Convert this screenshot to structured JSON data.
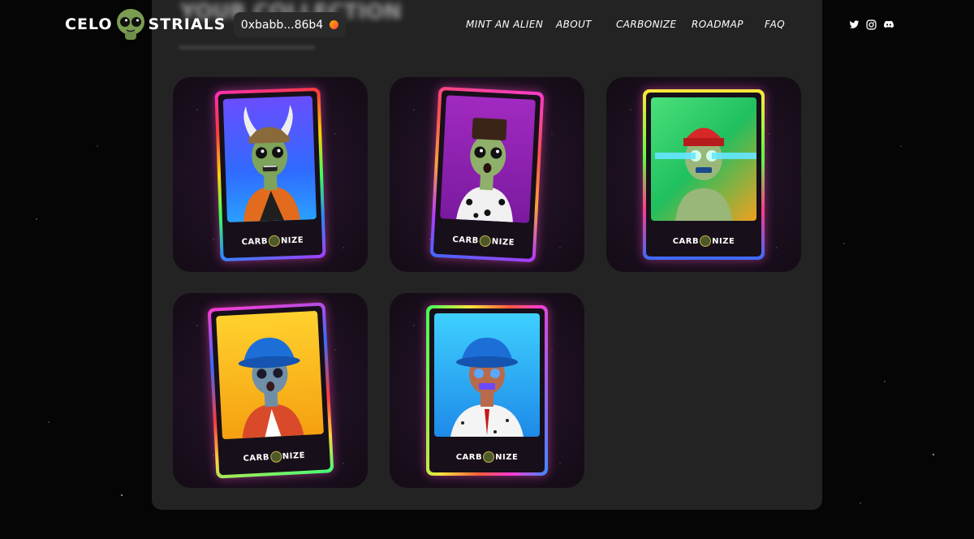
{
  "header": {
    "logo_left": "CELO",
    "logo_right": "STRIALS",
    "wallet_address": "0xbabb...86b4",
    "nav": [
      "MINT AN ALIEN",
      "ABOUT",
      "CARBONIZE",
      "ROADMAP",
      "FAQ"
    ],
    "socials": [
      "twitter-icon",
      "instagram-icon",
      "discord-icon"
    ]
  },
  "cards": [
    {
      "label_left": "CARB",
      "label_right": "NIZE",
      "background": "#3b5bff",
      "accessory": "viking-helmet",
      "skin": "#7ea35a"
    },
    {
      "label_left": "CARB",
      "label_right": "NIZE",
      "background": "#a12ac0",
      "accessory": "flat-top-hair",
      "skin": "#8fb06a"
    },
    {
      "label_left": "CARB",
      "label_right": "NIZE",
      "background": "#2fd06a",
      "accessory": "red-beanie-laser-eyes",
      "skin": "#9ab77a"
    },
    {
      "label_left": "CARB",
      "label_right": "NIZE",
      "background": "#f5b820",
      "accessory": "blue-bucket-hat",
      "skin": "#6f8fa8"
    },
    {
      "label_left": "CARB",
      "label_right": "NIZE",
      "background": "#35b8f0",
      "accessory": "blue-bucket-hat",
      "skin": "#b86a4a"
    }
  ]
}
